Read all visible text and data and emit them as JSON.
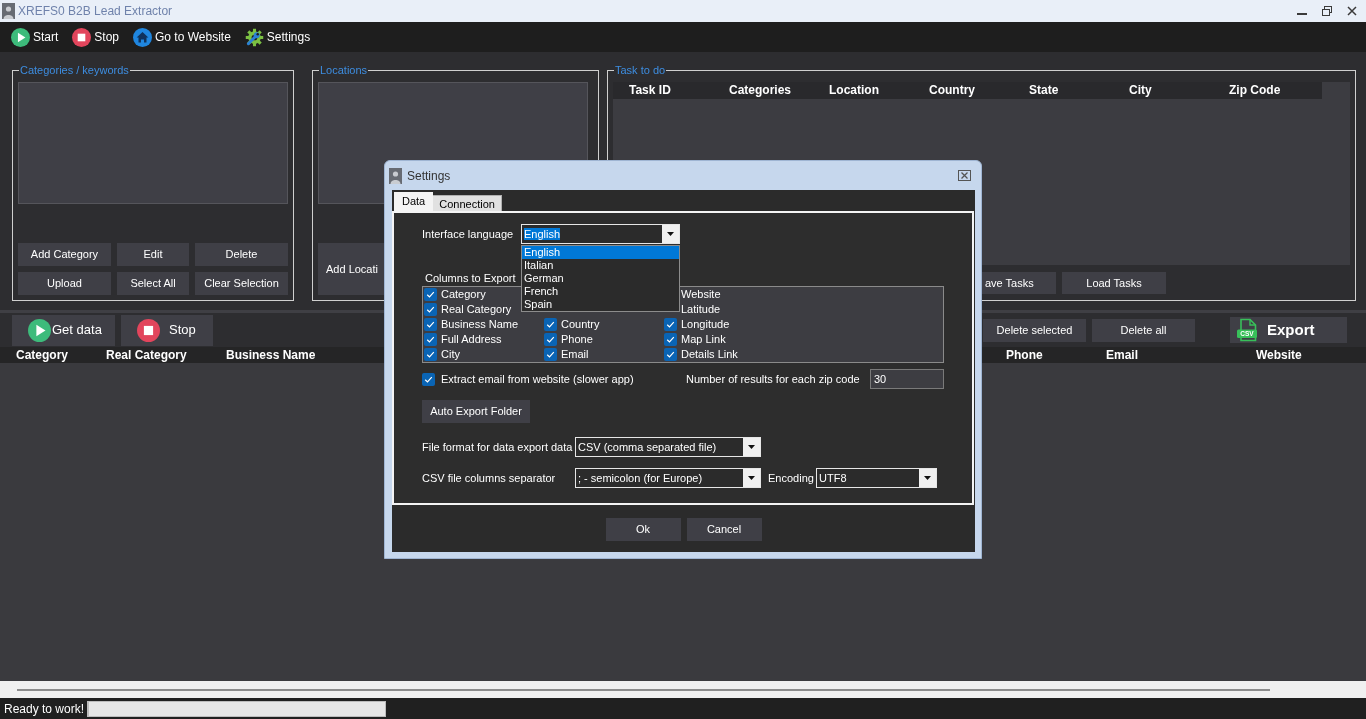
{
  "window": {
    "title": "XREFS0 B2B Lead Extractor"
  },
  "toolbar": [
    {
      "kind": "start",
      "label": "Start"
    },
    {
      "kind": "stop",
      "label": "Stop"
    },
    {
      "kind": "website",
      "label": "Go to Website"
    },
    {
      "kind": "settings",
      "label": "Settings"
    }
  ],
  "categories_panel": {
    "title": "Categories / keywords",
    "buttons": [
      "Add Category",
      "Edit",
      "Delete",
      "Upload",
      "Select All",
      "Clear Selection"
    ]
  },
  "locations_panel": {
    "title": "Locations",
    "buttons": [
      "Add Locati"
    ]
  },
  "tasks_panel": {
    "title": "Task to do",
    "columns": [
      "Task ID",
      "Categories",
      "Location",
      "Country",
      "State",
      "City",
      "Zip Code"
    ],
    "buttons": [
      "ave Tasks",
      "Load Tasks"
    ]
  },
  "results_toolbar": {
    "left": [
      {
        "kind": "start",
        "label": "Get data"
      },
      {
        "kind": "stop",
        "label": "Stop"
      }
    ],
    "right": [
      {
        "kind": "delete",
        "label": "Delete selected"
      },
      {
        "kind": "delete",
        "label": "Delete all"
      },
      {
        "kind": "export",
        "label": "Export",
        "icon_label": "CSV"
      }
    ]
  },
  "results_table": {
    "columns": [
      "Category",
      "Real Category",
      "Business Name",
      "Phone",
      "Email",
      "Website"
    ]
  },
  "settings_dialog": {
    "title": "Settings",
    "tabs": [
      {
        "label": "Data",
        "selected": true
      },
      {
        "label": "Connection",
        "selected": false
      }
    ],
    "interface_language": {
      "label": "Interface language",
      "value": "English",
      "value_highlighted": true,
      "expanded": true,
      "options": [
        {
          "label": "English",
          "selected": true
        },
        {
          "label": "Italian",
          "selected": false
        },
        {
          "label": "German",
          "selected": false
        },
        {
          "label": "French",
          "selected": false
        },
        {
          "label": "Spain",
          "selected": false
        }
      ]
    },
    "columns_to_export": {
      "label": "Columns to Export",
      "columns": [
        [
          {
            "label": "Category",
            "checked": true
          },
          {
            "label": "Real Category",
            "checked": true
          },
          {
            "label": "Business Name",
            "checked": true
          },
          {
            "label": "Full Address",
            "checked": true
          },
          {
            "label": "City",
            "checked": true
          }
        ],
        [
          {
            "label": "Country",
            "checked": true
          },
          {
            "label": "Phone",
            "checked": true
          },
          {
            "label": "Email",
            "checked": true
          }
        ],
        [
          {
            "label": "Website"
          },
          {
            "label": "Latitude"
          },
          {
            "label": "Longitude",
            "checked": true
          },
          {
            "label": "Map Link",
            "checked": true
          },
          {
            "label": "Details Link",
            "checked": true
          }
        ]
      ]
    },
    "extract_email": {
      "label": "Extract email from website (slower app)",
      "checked": true
    },
    "results_per_zip": {
      "label": "Number of results for each zip code",
      "value": "30"
    },
    "auto_export_button": "Auto Export Folder",
    "file_format": {
      "label": "File format for data export data",
      "value": "CSV (comma separated file)"
    },
    "separator": {
      "label": "CSV file columns separator",
      "value": "; - semicolon (for Europe)"
    },
    "encoding": {
      "label": "Encoding",
      "value": "UTF8"
    },
    "buttons": [
      "Ok",
      "Cancel"
    ]
  },
  "status_bar": {
    "text": "Ready to work!",
    "progress": {
      "level": 0
    }
  }
}
